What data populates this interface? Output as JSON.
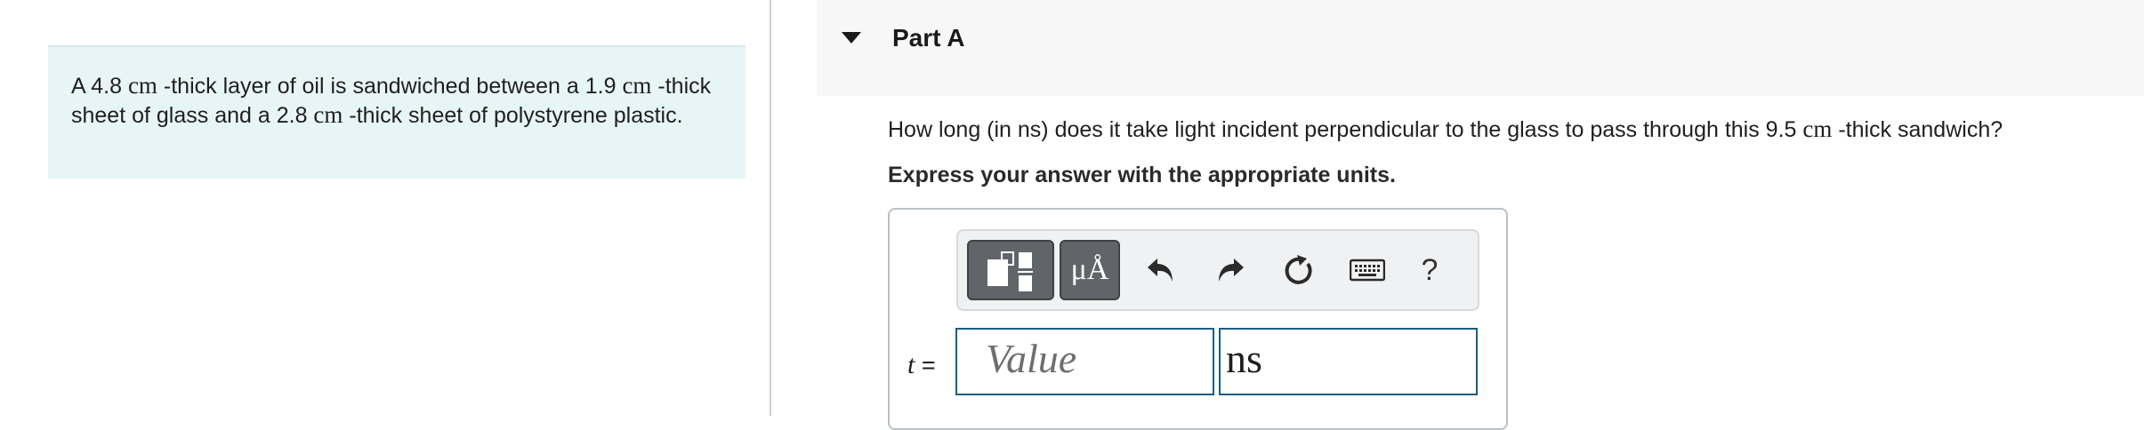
{
  "problem": {
    "text_1": "A 4.8 ",
    "unit_1": "cm",
    "text_2": " -thick layer of oil is sandwiched between a 1.9 ",
    "unit_2": "cm",
    "text_3": " -thick sheet of glass and a 2.8 ",
    "unit_3": "cm",
    "text_4": " -thick sheet of polystyrene plastic."
  },
  "part": {
    "title": "Part A",
    "question_1": "How long (in ns) does it take light incident perpendicular to the glass to pass through this 9.5 ",
    "question_unit": "cm",
    "question_2": " -thick sandwich?",
    "instruction": "Express your answer with the appropriate units."
  },
  "toolbar": {
    "templates_icon": "templates-icon",
    "units_label": "μÅ",
    "undo_icon": "undo-icon",
    "redo_icon": "redo-icon",
    "reset_icon": "reset-icon",
    "keyboard_icon": "keyboard-icon",
    "help_label": "?"
  },
  "answer": {
    "variable": "t",
    "equals": " =",
    "value_placeholder": "Value",
    "units_value": "ns"
  }
}
